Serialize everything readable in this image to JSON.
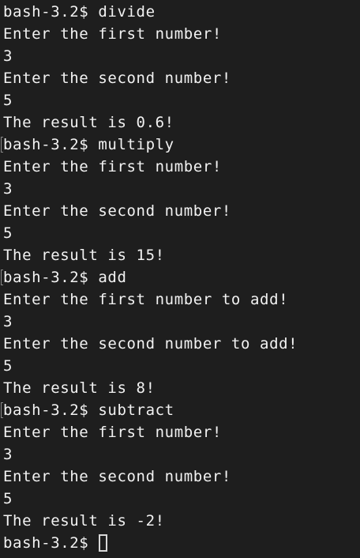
{
  "prompt": "bash-3.2$",
  "sessions": [
    {
      "command": "divide",
      "lines": [
        "Enter the first number!",
        "3",
        "Enter the second number!",
        "5",
        "The result is 0.6!"
      ]
    },
    {
      "command": "multiply",
      "lines": [
        "Enter the first number!",
        "3",
        "Enter the second number!",
        "5",
        "The result is 15!"
      ]
    },
    {
      "command": "add",
      "lines": [
        "Enter the first number to add!",
        "3",
        "Enter the second number to add!",
        "5",
        "The result is 8!"
      ]
    },
    {
      "command": "subtract",
      "lines": [
        "Enter the first number!",
        "3",
        "Enter the second number!",
        "5",
        "The result is -2!"
      ]
    }
  ],
  "final_prompt": "bash-3.2$"
}
